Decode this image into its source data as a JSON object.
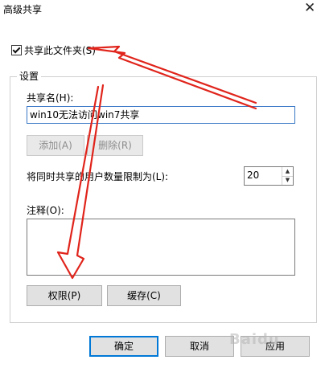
{
  "window": {
    "title": "高级共享"
  },
  "share_checkbox": {
    "label": "共享此文件夹(S)",
    "checked": true
  },
  "settings_group": {
    "legend": "设置"
  },
  "share_name": {
    "label": "共享名(H):",
    "value": "win10无法访问win7共享"
  },
  "buttons": {
    "add": "添加(A)",
    "remove": "删除(R)",
    "permissions": "权限(P)",
    "caching": "缓存(C)",
    "ok": "确定",
    "cancel": "取消",
    "apply": "应用"
  },
  "user_limit": {
    "label": "将同时共享的用户数量限制为(L):",
    "value": "20"
  },
  "comment": {
    "label": "注释(O):",
    "value": ""
  },
  "colors": {
    "annotation_arrow": "#e0241b",
    "accent": "#0078d7"
  },
  "watermark": {
    "text": "Baidu"
  }
}
